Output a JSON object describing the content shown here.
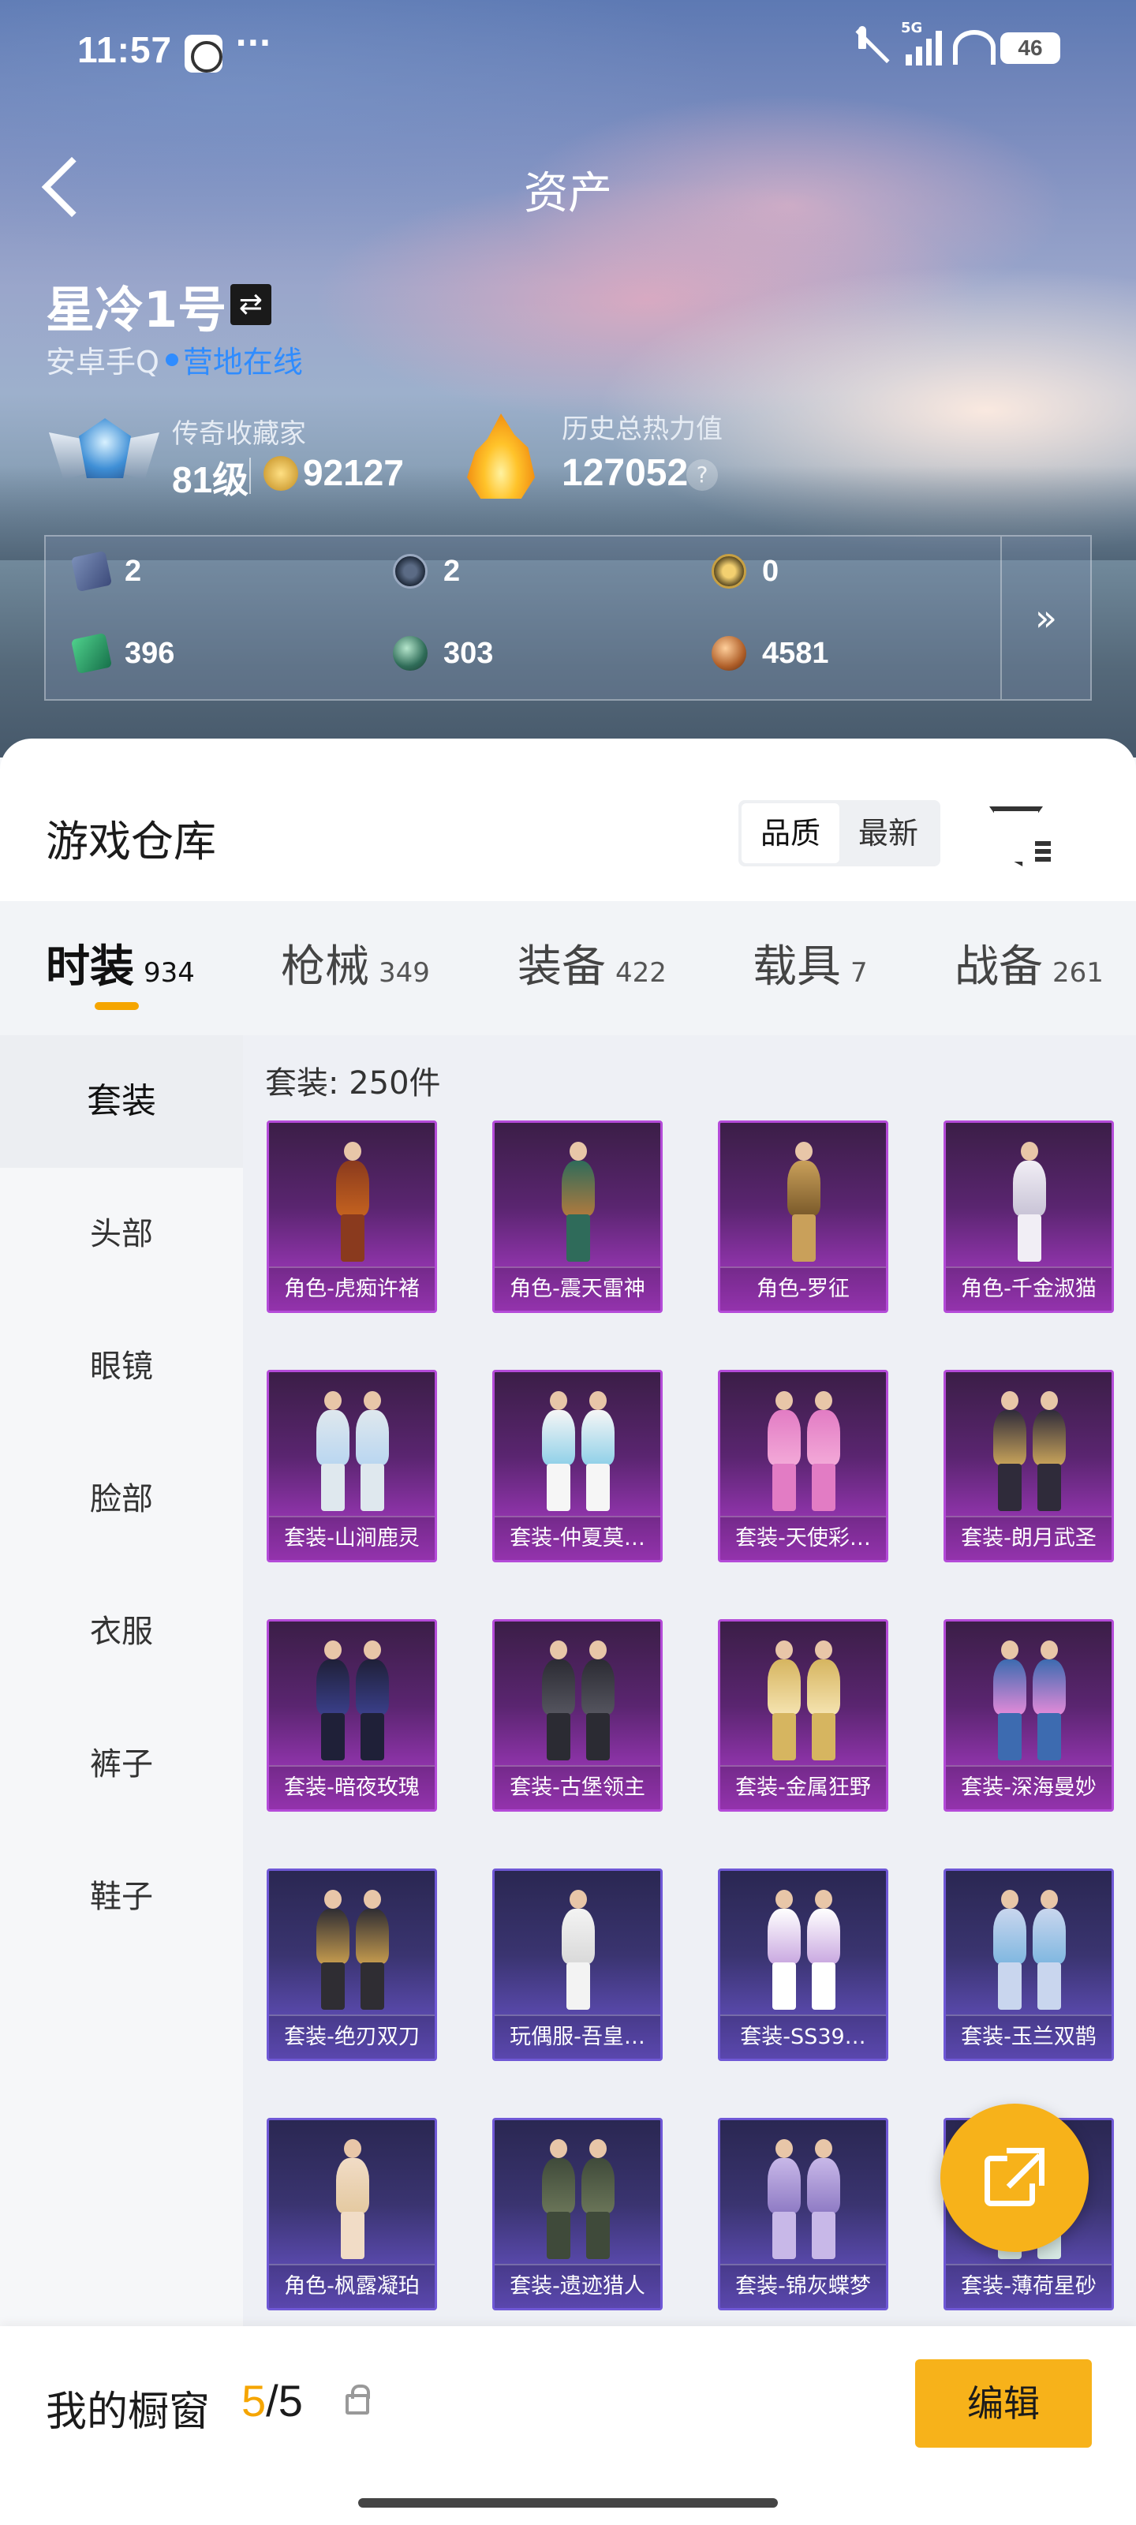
{
  "status_bar": {
    "time": "11:57",
    "dots": "···",
    "battery": "46",
    "network": "5G"
  },
  "header": {
    "title": "资产"
  },
  "profile": {
    "name": "星冷1号",
    "platform": "安卓手Q",
    "online_status": "营地在线",
    "collector_label": "传奇收藏家",
    "collector_level": "81级",
    "collector_points": "92127",
    "heat_label": "历史总热力值",
    "heat_value": "127052",
    "help": "?"
  },
  "stats": [
    {
      "icon": "card-icon",
      "value": "2"
    },
    {
      "icon": "s-medal-icon",
      "value": "2"
    },
    {
      "icon": "gold-medal-icon",
      "value": "0"
    },
    {
      "icon": "green-card-icon",
      "value": "396"
    },
    {
      "icon": "orb-icon",
      "value": "303"
    },
    {
      "icon": "bronze-coin-icon",
      "value": "4581"
    }
  ],
  "stats_more": "»",
  "warehouse": {
    "title": "游戏仓库",
    "sort_options": [
      "品质",
      "最新"
    ],
    "active_sort": "品质"
  },
  "tabs": [
    {
      "label": "时装",
      "count": "934",
      "active": true
    },
    {
      "label": "枪械",
      "count": "349",
      "active": false
    },
    {
      "label": "装备",
      "count": "422",
      "active": false
    },
    {
      "label": "载具",
      "count": "7",
      "active": false
    },
    {
      "label": "战备",
      "count": "261",
      "active": false
    }
  ],
  "sidebar": {
    "items": [
      "套装",
      "头部",
      "眼镜",
      "脸部",
      "衣服",
      "裤子",
      "鞋子"
    ],
    "active": "套装"
  },
  "content": {
    "count_label": "套装: 250件",
    "items": [
      {
        "name": "角色-虎痴许褚",
        "rarity": "purple"
      },
      {
        "name": "角色-震天雷神",
        "rarity": "purple"
      },
      {
        "name": "角色-罗征",
        "rarity": "purple"
      },
      {
        "name": "角色-千金淑猫",
        "rarity": "purple"
      },
      {
        "name": "套装-山涧鹿灵",
        "rarity": "purple"
      },
      {
        "name": "套装-仲夏莫…",
        "rarity": "purple"
      },
      {
        "name": "套装-天使彩…",
        "rarity": "purple"
      },
      {
        "name": "套装-朗月武圣",
        "rarity": "purple"
      },
      {
        "name": "套装-暗夜玫瑰",
        "rarity": "purple"
      },
      {
        "name": "套装-古堡领主",
        "rarity": "purple"
      },
      {
        "name": "套装-金属狂野",
        "rarity": "purple"
      },
      {
        "name": "套装-深海曼妙",
        "rarity": "purple"
      },
      {
        "name": "套装-绝刃双刀",
        "rarity": "blue"
      },
      {
        "name": "玩偶服-吾皇…",
        "rarity": "blue"
      },
      {
        "name": "套装-SS39…",
        "rarity": "blue"
      },
      {
        "name": "套装-玉兰双鹊",
        "rarity": "blue"
      },
      {
        "name": "角色-枫露凝珀",
        "rarity": "blue"
      },
      {
        "name": "套装-遗迹猎人",
        "rarity": "blue"
      },
      {
        "name": "套装-锦灰蝶梦",
        "rarity": "blue"
      },
      {
        "name": "套装-薄荷星砂",
        "rarity": "blue"
      }
    ]
  },
  "showcase": {
    "label": "我的橱窗",
    "current": "5",
    "total": "/5",
    "edit_label": "编辑"
  },
  "colors": {
    "accent": "#f7b21a",
    "online": "#2f8cff",
    "purple_rarity": "#b44bd8",
    "blue_rarity": "#6f58d6"
  }
}
